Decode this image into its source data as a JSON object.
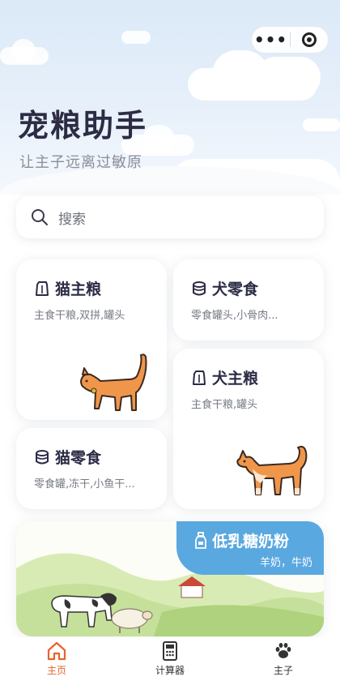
{
  "header": {
    "title": "宠粮助手",
    "subtitle": "让主子远离过敏原"
  },
  "capsule": {
    "more_icon": "more-dots-icon",
    "close_icon": "target-icon"
  },
  "search": {
    "placeholder": "搜索"
  },
  "categories": [
    {
      "title": "猫主粮",
      "desc": "主食干粮,双拼,罐头",
      "icon": "bag-icon"
    },
    {
      "title": "犬零食",
      "desc": "零食罐头,小骨肉...",
      "icon": "can-icon"
    },
    {
      "title": "犬主粮",
      "desc": "主食干粮,罐头",
      "icon": "bag-icon"
    },
    {
      "title": "猫零食",
      "desc": "零食罐,冻干,小鱼干...",
      "icon": "can-icon"
    }
  ],
  "banner": {
    "title": "低乳糖奶粉",
    "subtitle": "羊奶，牛奶",
    "accent": "#5aa8e0"
  },
  "tabbar": {
    "items": [
      {
        "label": "主页",
        "icon": "home-icon",
        "active": true
      },
      {
        "label": "计算器",
        "icon": "calculator-icon",
        "active": false
      },
      {
        "label": "主子",
        "icon": "paw-icon",
        "active": false
      }
    ],
    "active_color": "#e9622b"
  }
}
